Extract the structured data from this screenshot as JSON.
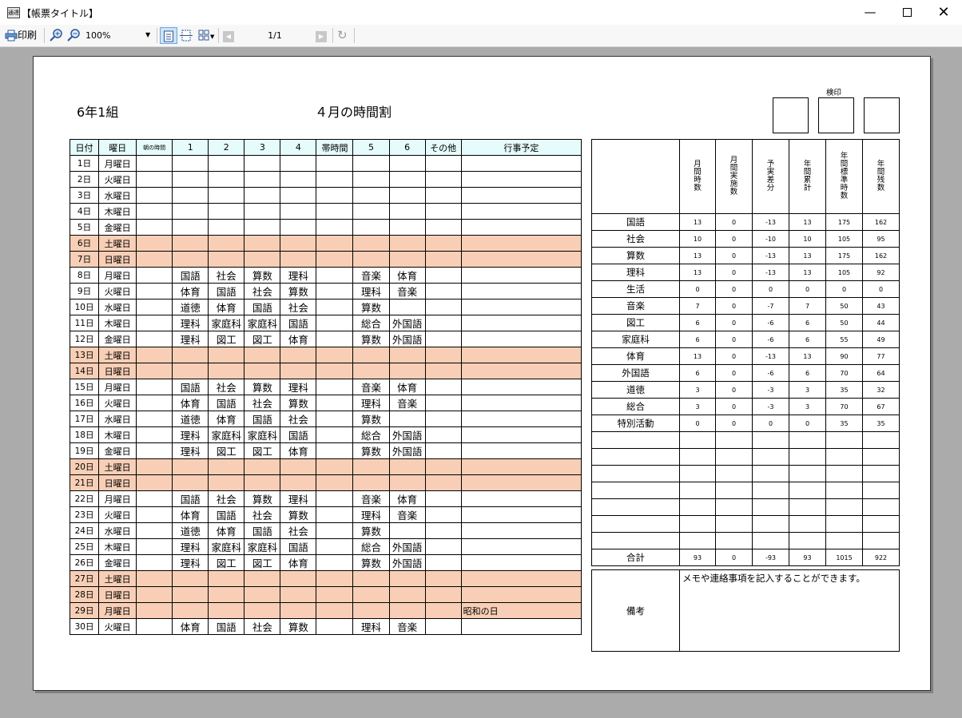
{
  "window": {
    "title": "【帳票タイトル】",
    "icon_text": "通達"
  },
  "toolbar": {
    "print_label": "印刷",
    "zoom": "100%",
    "page_indicator": "1/1"
  },
  "report": {
    "class_label": "6年1組",
    "title": "４月の時間割",
    "stamp_label": "検印",
    "schedule_headers": [
      "日付",
      "曜日",
      "朝の時間",
      "1",
      "2",
      "3",
      "4",
      "帯時間",
      "5",
      "6",
      "その他",
      "行事予定"
    ],
    "schedule_rows": [
      {
        "date": "1日",
        "wd": "月曜日",
        "p": [
          "",
          "",
          "",
          "",
          "",
          "",
          ""
        ],
        "event": "",
        "weekend": false
      },
      {
        "date": "2日",
        "wd": "火曜日",
        "p": [
          "",
          "",
          "",
          "",
          "",
          "",
          ""
        ],
        "event": "",
        "weekend": false
      },
      {
        "date": "3日",
        "wd": "水曜日",
        "p": [
          "",
          "",
          "",
          "",
          "",
          "",
          ""
        ],
        "event": "",
        "weekend": false
      },
      {
        "date": "4日",
        "wd": "木曜日",
        "p": [
          "",
          "",
          "",
          "",
          "",
          "",
          ""
        ],
        "event": "",
        "weekend": false
      },
      {
        "date": "5日",
        "wd": "金曜日",
        "p": [
          "",
          "",
          "",
          "",
          "",
          "",
          ""
        ],
        "event": "",
        "weekend": false
      },
      {
        "date": "6日",
        "wd": "土曜日",
        "p": [
          "",
          "",
          "",
          "",
          "",
          "",
          ""
        ],
        "event": "",
        "weekend": true
      },
      {
        "date": "7日",
        "wd": "日曜日",
        "p": [
          "",
          "",
          "",
          "",
          "",
          "",
          ""
        ],
        "event": "",
        "weekend": true
      },
      {
        "date": "8日",
        "wd": "月曜日",
        "p": [
          "国語",
          "社会",
          "算数",
          "理科",
          "",
          "音楽",
          "体育"
        ],
        "event": "",
        "weekend": false
      },
      {
        "date": "9日",
        "wd": "火曜日",
        "p": [
          "体育",
          "国語",
          "社会",
          "算数",
          "",
          "理科",
          "音楽"
        ],
        "event": "",
        "weekend": false
      },
      {
        "date": "10日",
        "wd": "水曜日",
        "p": [
          "道徳",
          "体育",
          "国語",
          "社会",
          "",
          "算数",
          ""
        ],
        "event": "",
        "weekend": false
      },
      {
        "date": "11日",
        "wd": "木曜日",
        "p": [
          "理科",
          "家庭科",
          "家庭科",
          "国語",
          "",
          "総合",
          "外国語"
        ],
        "event": "",
        "weekend": false
      },
      {
        "date": "12日",
        "wd": "金曜日",
        "p": [
          "理科",
          "図工",
          "図工",
          "体育",
          "",
          "算数",
          "外国語"
        ],
        "event": "",
        "weekend": false
      },
      {
        "date": "13日",
        "wd": "土曜日",
        "p": [
          "",
          "",
          "",
          "",
          "",
          "",
          ""
        ],
        "event": "",
        "weekend": true
      },
      {
        "date": "14日",
        "wd": "日曜日",
        "p": [
          "",
          "",
          "",
          "",
          "",
          "",
          ""
        ],
        "event": "",
        "weekend": true
      },
      {
        "date": "15日",
        "wd": "月曜日",
        "p": [
          "国語",
          "社会",
          "算数",
          "理科",
          "",
          "音楽",
          "体育"
        ],
        "event": "",
        "weekend": false
      },
      {
        "date": "16日",
        "wd": "火曜日",
        "p": [
          "体育",
          "国語",
          "社会",
          "算数",
          "",
          "理科",
          "音楽"
        ],
        "event": "",
        "weekend": false
      },
      {
        "date": "17日",
        "wd": "水曜日",
        "p": [
          "道徳",
          "体育",
          "国語",
          "社会",
          "",
          "算数",
          ""
        ],
        "event": "",
        "weekend": false
      },
      {
        "date": "18日",
        "wd": "木曜日",
        "p": [
          "理科",
          "家庭科",
          "家庭科",
          "国語",
          "",
          "総合",
          "外国語"
        ],
        "event": "",
        "weekend": false
      },
      {
        "date": "19日",
        "wd": "金曜日",
        "p": [
          "理科",
          "図工",
          "図工",
          "体育",
          "",
          "算数",
          "外国語"
        ],
        "event": "",
        "weekend": false
      },
      {
        "date": "20日",
        "wd": "土曜日",
        "p": [
          "",
          "",
          "",
          "",
          "",
          "",
          ""
        ],
        "event": "",
        "weekend": true
      },
      {
        "date": "21日",
        "wd": "日曜日",
        "p": [
          "",
          "",
          "",
          "",
          "",
          "",
          ""
        ],
        "event": "",
        "weekend": true
      },
      {
        "date": "22日",
        "wd": "月曜日",
        "p": [
          "国語",
          "社会",
          "算数",
          "理科",
          "",
          "音楽",
          "体育"
        ],
        "event": "",
        "weekend": false
      },
      {
        "date": "23日",
        "wd": "火曜日",
        "p": [
          "体育",
          "国語",
          "社会",
          "算数",
          "",
          "理科",
          "音楽"
        ],
        "event": "",
        "weekend": false
      },
      {
        "date": "24日",
        "wd": "水曜日",
        "p": [
          "道徳",
          "体育",
          "国語",
          "社会",
          "",
          "算数",
          ""
        ],
        "event": "",
        "weekend": false
      },
      {
        "date": "25日",
        "wd": "木曜日",
        "p": [
          "理科",
          "家庭科",
          "家庭科",
          "国語",
          "",
          "総合",
          "外国語"
        ],
        "event": "",
        "weekend": false
      },
      {
        "date": "26日",
        "wd": "金曜日",
        "p": [
          "理科",
          "図工",
          "図工",
          "体育",
          "",
          "算数",
          "外国語"
        ],
        "event": "",
        "weekend": false
      },
      {
        "date": "27日",
        "wd": "土曜日",
        "p": [
          "",
          "",
          "",
          "",
          "",
          "",
          ""
        ],
        "event": "",
        "weekend": true
      },
      {
        "date": "28日",
        "wd": "日曜日",
        "p": [
          "",
          "",
          "",
          "",
          "",
          "",
          ""
        ],
        "event": "",
        "weekend": true
      },
      {
        "date": "29日",
        "wd": "月曜日",
        "p": [
          "",
          "",
          "",
          "",
          "",
          "",
          ""
        ],
        "event": "昭和の日",
        "weekend": true
      },
      {
        "date": "30日",
        "wd": "火曜日",
        "p": [
          "体育",
          "国語",
          "社会",
          "算数",
          "",
          "理科",
          "音楽"
        ],
        "event": "",
        "weekend": false
      }
    ],
    "stats_headers": [
      "月間時数",
      "月間実施数",
      "予実差分",
      "年間累計",
      "年間標準時数",
      "年間残数"
    ],
    "stats_rows": [
      {
        "subject": "国語",
        "values": [
          "13",
          "0",
          "-13",
          "13",
          "175",
          "162"
        ]
      },
      {
        "subject": "社会",
        "values": [
          "10",
          "0",
          "-10",
          "10",
          "105",
          "95"
        ]
      },
      {
        "subject": "算数",
        "values": [
          "13",
          "0",
          "-13",
          "13",
          "175",
          "162"
        ]
      },
      {
        "subject": "理科",
        "values": [
          "13",
          "0",
          "-13",
          "13",
          "105",
          "92"
        ]
      },
      {
        "subject": "生活",
        "values": [
          "0",
          "0",
          "0",
          "0",
          "0",
          "0"
        ]
      },
      {
        "subject": "音楽",
        "values": [
          "7",
          "0",
          "-7",
          "7",
          "50",
          "43"
        ]
      },
      {
        "subject": "図工",
        "values": [
          "6",
          "0",
          "-6",
          "6",
          "50",
          "44"
        ]
      },
      {
        "subject": "家庭科",
        "values": [
          "6",
          "0",
          "-6",
          "6",
          "55",
          "49"
        ]
      },
      {
        "subject": "体育",
        "values": [
          "13",
          "0",
          "-13",
          "13",
          "90",
          "77"
        ]
      },
      {
        "subject": "外国語",
        "values": [
          "6",
          "0",
          "-6",
          "6",
          "70",
          "64"
        ]
      },
      {
        "subject": "道徳",
        "values": [
          "3",
          "0",
          "-3",
          "3",
          "35",
          "32"
        ]
      },
      {
        "subject": "総合",
        "values": [
          "3",
          "0",
          "-3",
          "3",
          "70",
          "67"
        ]
      },
      {
        "subject": "特別活動",
        "values": [
          "0",
          "0",
          "0",
          "0",
          "35",
          "35"
        ]
      },
      {
        "subject": "",
        "values": [
          "",
          "",
          "",
          "",
          "",
          ""
        ]
      },
      {
        "subject": "",
        "values": [
          "",
          "",
          "",
          "",
          "",
          ""
        ]
      },
      {
        "subject": "",
        "values": [
          "",
          "",
          "",
          "",
          "",
          ""
        ]
      },
      {
        "subject": "",
        "values": [
          "",
          "",
          "",
          "",
          "",
          ""
        ]
      },
      {
        "subject": "",
        "values": [
          "",
          "",
          "",
          "",
          "",
          ""
        ]
      },
      {
        "subject": "",
        "values": [
          "",
          "",
          "",
          "",
          "",
          ""
        ]
      },
      {
        "subject": "",
        "values": [
          "",
          "",
          "",
          "",
          "",
          ""
        ]
      }
    ],
    "stats_total": {
      "subject": "合計",
      "values": [
        "93",
        "0",
        "-93",
        "93",
        "1015",
        "922"
      ]
    },
    "notes_label": "備考",
    "notes_text": "メモや連絡事項を記入することができます。"
  }
}
